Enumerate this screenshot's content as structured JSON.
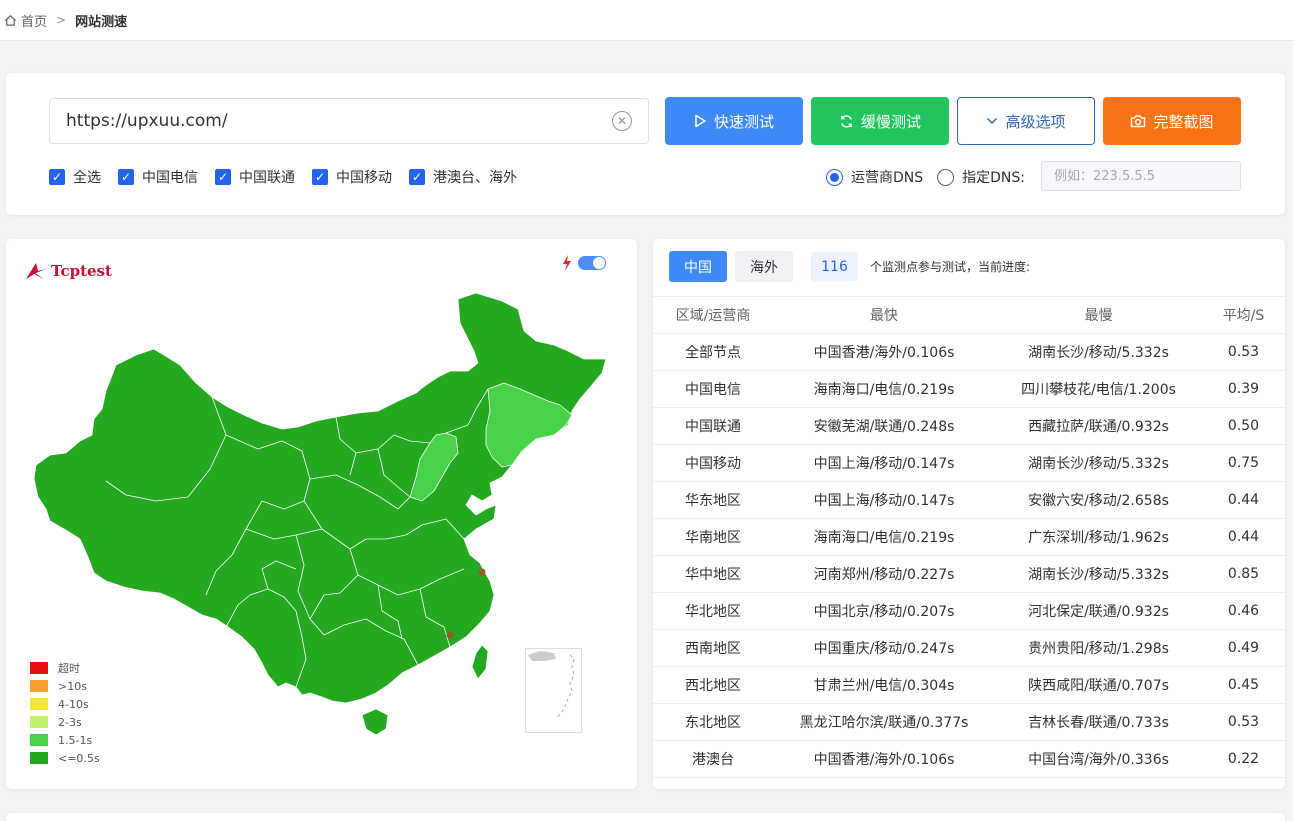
{
  "breadcrumb": {
    "home": "首页",
    "current": "网站测速"
  },
  "search": {
    "url": "https://upxuu.com/",
    "quick_label": "快速测试",
    "slow_label": "缓慢测试",
    "advanced_label": "高级选项",
    "screenshot_label": "完整截图",
    "checks": [
      "全选",
      "中国电信",
      "中国联通",
      "中国移动",
      "港澳台、海外"
    ],
    "dns_operator": "运营商DNS",
    "dns_custom": "指定DNS:",
    "dns_placeholder": "例如：223.5.5.5"
  },
  "map": {
    "logo": "Tcptest",
    "legend": [
      "超时",
      ">10s",
      "4-10s",
      "2-3s",
      "1.5-1s",
      "<=0.5s"
    ],
    "legend_colors": [
      "#e01010",
      "#f4a034",
      "#f2e93b",
      "#c2f06d",
      "#47d24a",
      "#23a820"
    ]
  },
  "results": {
    "tabs": [
      "中国",
      "海外"
    ],
    "count": "116",
    "progress_text": "个监测点参与测试，当前进度:",
    "headers": [
      "区域/运营商",
      "最快",
      "最慢",
      "平均/S"
    ],
    "rows": [
      [
        "全部节点",
        "中国香港/海外/0.106s",
        "湖南长沙/移动/5.332s",
        "0.53"
      ],
      [
        "中国电信",
        "海南海口/电信/0.219s",
        "四川攀枝花/电信/1.200s",
        "0.39"
      ],
      [
        "中国联通",
        "安徽芜湖/联通/0.248s",
        "西藏拉萨/联通/0.932s",
        "0.50"
      ],
      [
        "中国移动",
        "中国上海/移动/0.147s",
        "湖南长沙/移动/5.332s",
        "0.75"
      ],
      [
        "华东地区",
        "中国上海/移动/0.147s",
        "安徽六安/移动/2.658s",
        "0.44"
      ],
      [
        "华南地区",
        "海南海口/电信/0.219s",
        "广东深圳/移动/1.962s",
        "0.44"
      ],
      [
        "华中地区",
        "河南郑州/移动/0.227s",
        "湖南长沙/移动/5.332s",
        "0.85"
      ],
      [
        "华北地区",
        "中国北京/移动/0.207s",
        "河北保定/联通/0.932s",
        "0.46"
      ],
      [
        "西南地区",
        "中国重庆/移动/0.247s",
        "贵州贵阳/移动/1.298s",
        "0.49"
      ],
      [
        "西北地区",
        "甘肃兰州/电信/0.304s",
        "陕西咸阳/联通/0.707s",
        "0.45"
      ],
      [
        "东北地区",
        "黑龙江哈尔滨/联通/0.377s",
        "吉林长春/联通/0.733s",
        "0.53"
      ],
      [
        "港澳台",
        "中国香港/海外/0.106s",
        "中国台湾/海外/0.336s",
        "0.22"
      ]
    ]
  }
}
